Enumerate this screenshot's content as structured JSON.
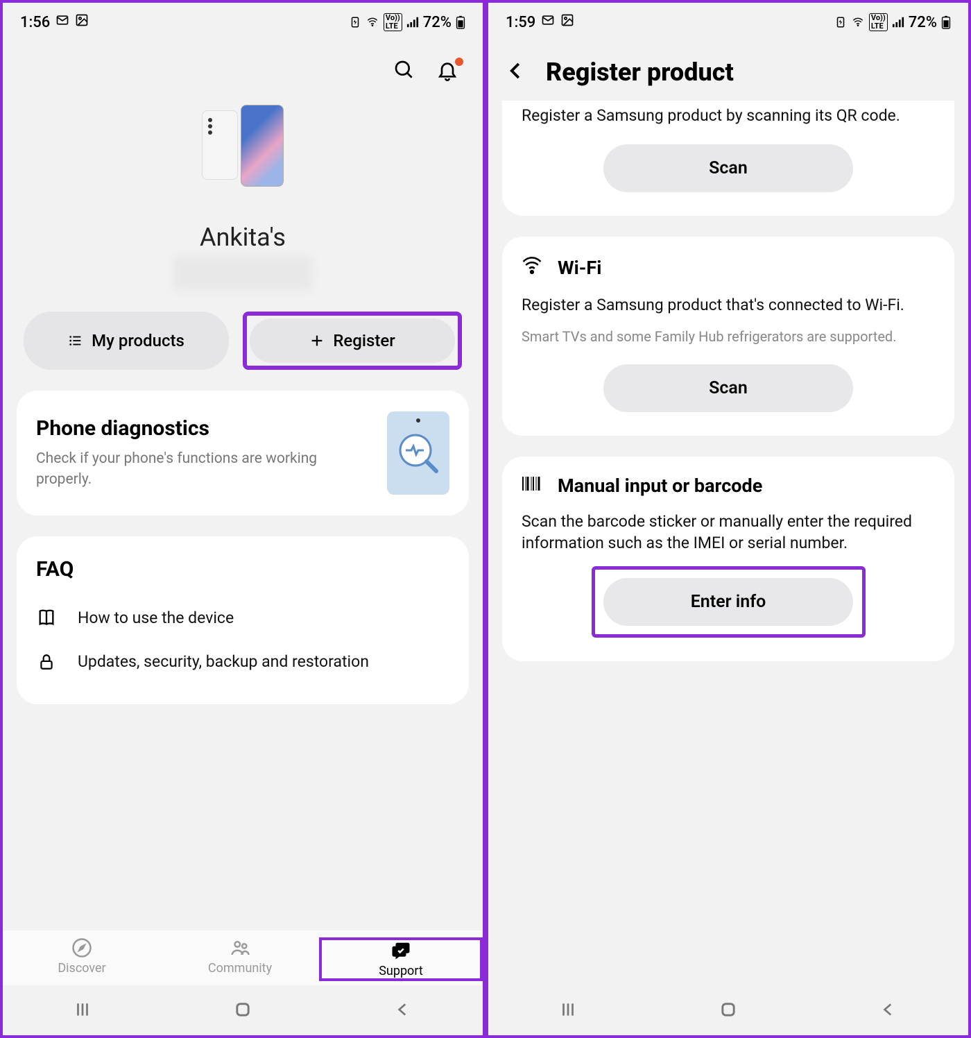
{
  "left": {
    "status": {
      "time": "1:56",
      "battery": "72%"
    },
    "device_name": "Ankita's",
    "chips": {
      "my_products": "My products",
      "register": "Register"
    },
    "diagnostics": {
      "title": "Phone diagnostics",
      "subtitle": "Check if your phone's functions are working properly."
    },
    "faq": {
      "title": "FAQ",
      "items": [
        "How to use the device",
        "Updates, security, backup and restoration"
      ]
    },
    "nav": {
      "discover": "Discover",
      "community": "Community",
      "support": "Support"
    }
  },
  "right": {
    "status": {
      "time": "1:59",
      "battery": "72%"
    },
    "page_title": "Register product",
    "qr": {
      "desc": "Register a Samsung product by scanning its QR code.",
      "button": "Scan"
    },
    "wifi": {
      "title": "Wi-Fi",
      "desc": "Register a Samsung product that's connected to Wi-Fi.",
      "sub": "Smart TVs and some Family Hub refrigerators are supported.",
      "button": "Scan"
    },
    "manual": {
      "title": "Manual input or barcode",
      "desc": "Scan the barcode sticker or manually enter the required information such as the IMEI or serial number.",
      "button": "Enter info"
    }
  }
}
